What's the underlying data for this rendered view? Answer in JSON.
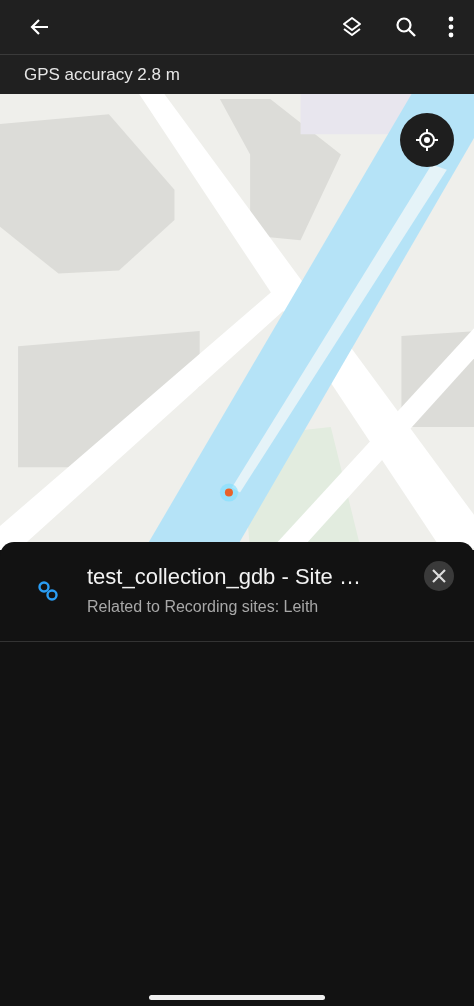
{
  "gps_bar": {
    "text": "GPS accuracy 2.8 m"
  },
  "sheet": {
    "title": "test_collection_gdb - Site …",
    "subtitle": "Related to Recording sites: Leith"
  }
}
